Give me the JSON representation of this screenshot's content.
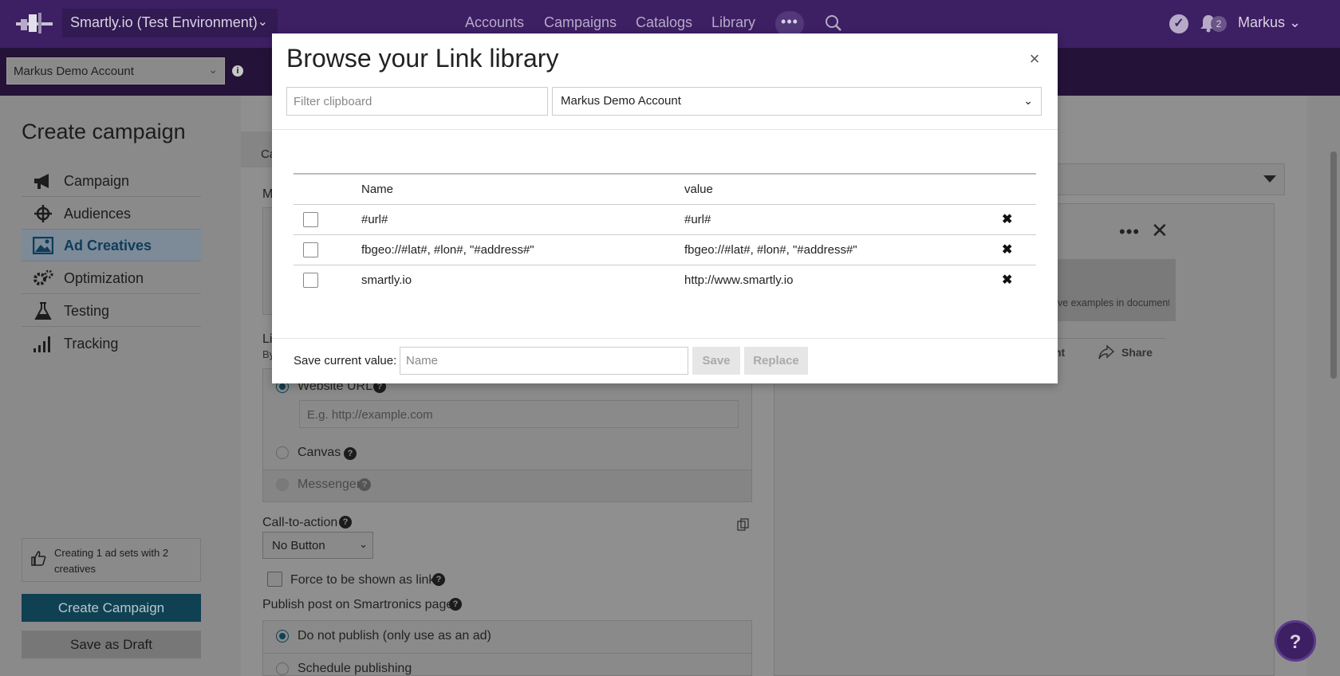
{
  "app": {
    "env_label": "Smartly.io (Test Environment)",
    "nav": [
      "Accounts",
      "Campaigns",
      "Catalogs",
      "Library"
    ],
    "more_label": "•••",
    "notification_count": "2",
    "user_name": "Markus"
  },
  "subbar": {
    "account": "Markus Demo Account",
    "info": "i"
  },
  "sidebar": {
    "title": "Create campaign",
    "items": [
      {
        "label": "Campaign",
        "icon": "megaphone-icon"
      },
      {
        "label": "Audiences",
        "icon": "crosshair-icon"
      },
      {
        "label": "Ad Creatives",
        "icon": "image-icon"
      },
      {
        "label": "Optimization",
        "icon": "gears-icon"
      },
      {
        "label": "Testing",
        "icon": "flask-icon"
      },
      {
        "label": "Tracking",
        "icon": "signal-bars-icon"
      }
    ],
    "active_index": 2,
    "summary": "Creating 1 ad sets with 2 creatives",
    "create_button": "Create Campaign",
    "draft_button": "Save as Draft"
  },
  "main": {
    "tab_fragment": "Ca",
    "message_fragment": "M",
    "link_fragment": "Li",
    "link_sub_fragment": "By",
    "website_url_label": "Website URL",
    "website_url_placeholder": "E.g. http://example.com",
    "canvas_label": "Canvas",
    "messenger_label": "Messenger",
    "cta_label": "Call-to-action",
    "cta_value": "No Button",
    "force_link_label": "Force to be shown as link",
    "publish_label": "Publish post on Smartronics page",
    "publish_options": [
      "Do not publish (only use as an ad)",
      "Schedule publishing"
    ],
    "help_glyph": "?"
  },
  "preview": {
    "more_label": "•••",
    "close_label": "✕",
    "grey_text": "ve examples in documentation",
    "comment_fragment": "nt",
    "share_label": "Share"
  },
  "modal": {
    "title": "Browse your Link library",
    "close_label": "×",
    "filter_placeholder": "Filter clipboard",
    "account_select": "Markus Demo Account",
    "columns": {
      "name": "Name",
      "value": "value"
    },
    "rows": [
      {
        "name": "#url#",
        "value": "#url#"
      },
      {
        "name": "fbgeo://#lat#, #lon#, \"#address#\"",
        "value": "fbgeo://#lat#, #lon#, \"#address#\""
      },
      {
        "name": "smartly.io",
        "value": "http://www.smartly.io"
      }
    ],
    "delete_glyph": "✖",
    "save_label": "Save current value:",
    "save_placeholder": "Name",
    "save_button": "Save",
    "replace_button": "Replace"
  }
}
